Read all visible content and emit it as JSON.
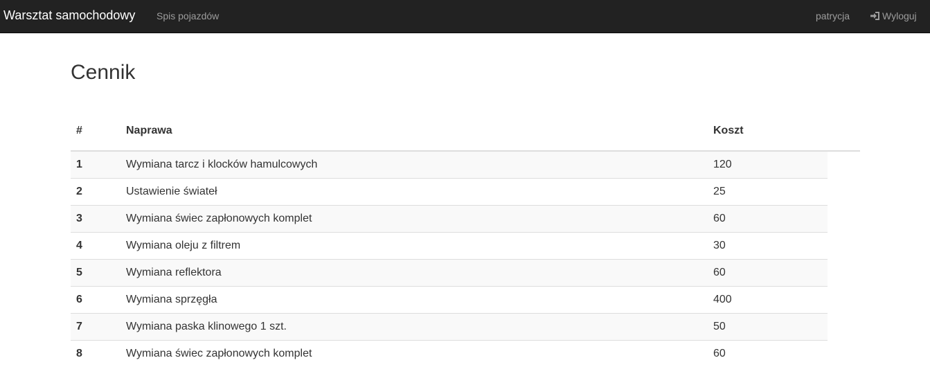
{
  "navbar": {
    "brand": "Warsztat samochodowy",
    "vehicles_link": "Spis pojazdów",
    "user": "patrycja",
    "logout": "Wyloguj",
    "logout_icon": "log-in-icon"
  },
  "page": {
    "title": "Cennik"
  },
  "table": {
    "headers": {
      "num": "#",
      "repair": "Naprawa",
      "cost": "Koszt"
    },
    "rows": [
      {
        "num": "1",
        "repair": "Wymiana tarcz i klocków hamulcowych",
        "cost": "120"
      },
      {
        "num": "2",
        "repair": "Ustawienie świateł",
        "cost": "25"
      },
      {
        "num": "3",
        "repair": "Wymiana świec zapłonowych komplet",
        "cost": "60"
      },
      {
        "num": "4",
        "repair": "Wymiana oleju z filtrem",
        "cost": "30"
      },
      {
        "num": "5",
        "repair": "Wymiana reflektora",
        "cost": "60"
      },
      {
        "num": "6",
        "repair": "Wymiana sprzęgła",
        "cost": "400"
      },
      {
        "num": "7",
        "repair": "Wymiana paska klinowego 1 szt.",
        "cost": "50"
      },
      {
        "num": "8",
        "repair": "Wymiana świec zapłonowych komplet",
        "cost": "60"
      }
    ]
  },
  "colors": {
    "navbar_bg": "#222222",
    "nav_link": "#9d9d9d",
    "brand": "#ffffff",
    "stripe": "#f9f9f9",
    "border": "#dddddd"
  }
}
